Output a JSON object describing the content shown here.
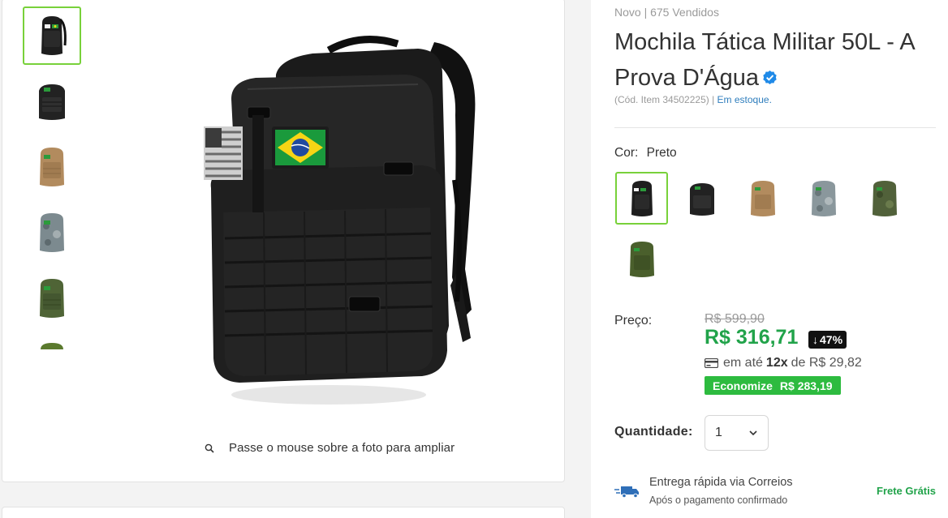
{
  "gallery": {
    "thumbnails": [
      {
        "icon": "backpack-black-flag-icon",
        "color": "#1e1e1e",
        "active": true
      },
      {
        "icon": "backpack-black-icon",
        "color": "#222222",
        "active": false
      },
      {
        "icon": "backpack-tan-icon",
        "color": "#b28b5e",
        "active": false
      },
      {
        "icon": "backpack-camo-icon",
        "color": "#7c8a8f",
        "active": false
      },
      {
        "icon": "backpack-green-icon",
        "color": "#4f6436",
        "active": false
      },
      {
        "icon": "backpack-green-partial-icon",
        "color": "#5b7a2e",
        "active": false
      }
    ],
    "zoom_hint": "Passe o mouse sobre a foto para ampliar"
  },
  "product": {
    "meta": "Novo | 675 Vendidos",
    "title": "Mochila Tática Militar 50L - A Prova D'Água",
    "sku": "(Cód. Item 34502225) |",
    "stock": "Em estoque."
  },
  "color": {
    "label": "Cor:",
    "selected": "Preto",
    "swatches": [
      {
        "icon": "swatch-black-flag-icon",
        "color": "#1e1e1e",
        "selected": true
      },
      {
        "icon": "swatch-black-icon",
        "color": "#222222",
        "selected": false
      },
      {
        "icon": "swatch-tan-icon",
        "color": "#b28b5e",
        "selected": false
      },
      {
        "icon": "swatch-camo-icon",
        "color": "#8a979c",
        "selected": false
      },
      {
        "icon": "swatch-green-camo-icon",
        "color": "#51613a",
        "selected": false
      },
      {
        "icon": "swatch-green-icon",
        "color": "#4a5f2c",
        "selected": false
      }
    ]
  },
  "price": {
    "label": "Preço:",
    "old": "R$ 599,90",
    "current": "R$ 316,71",
    "discount_arrow": "↓",
    "discount": "47%",
    "installments_prefix": "em até",
    "installments_count": "12x",
    "installments_suffix": "de R$ 29,82",
    "economize_label": "Economize",
    "economize_value": "R$ 283,19"
  },
  "quantity": {
    "label": "Quantidade:",
    "value": "1"
  },
  "shipping": {
    "title": "Entrega rápida via Correios",
    "subtitle": "Após o pagamento confirmado",
    "badge": "Frete Grátis"
  },
  "colors": {
    "accent_green": "#21a34a",
    "economize_bg": "#2dbb3f",
    "selected_border": "#78d13a",
    "link_blue": "#2f7ebd",
    "verified_blue": "#1f8ae8"
  }
}
